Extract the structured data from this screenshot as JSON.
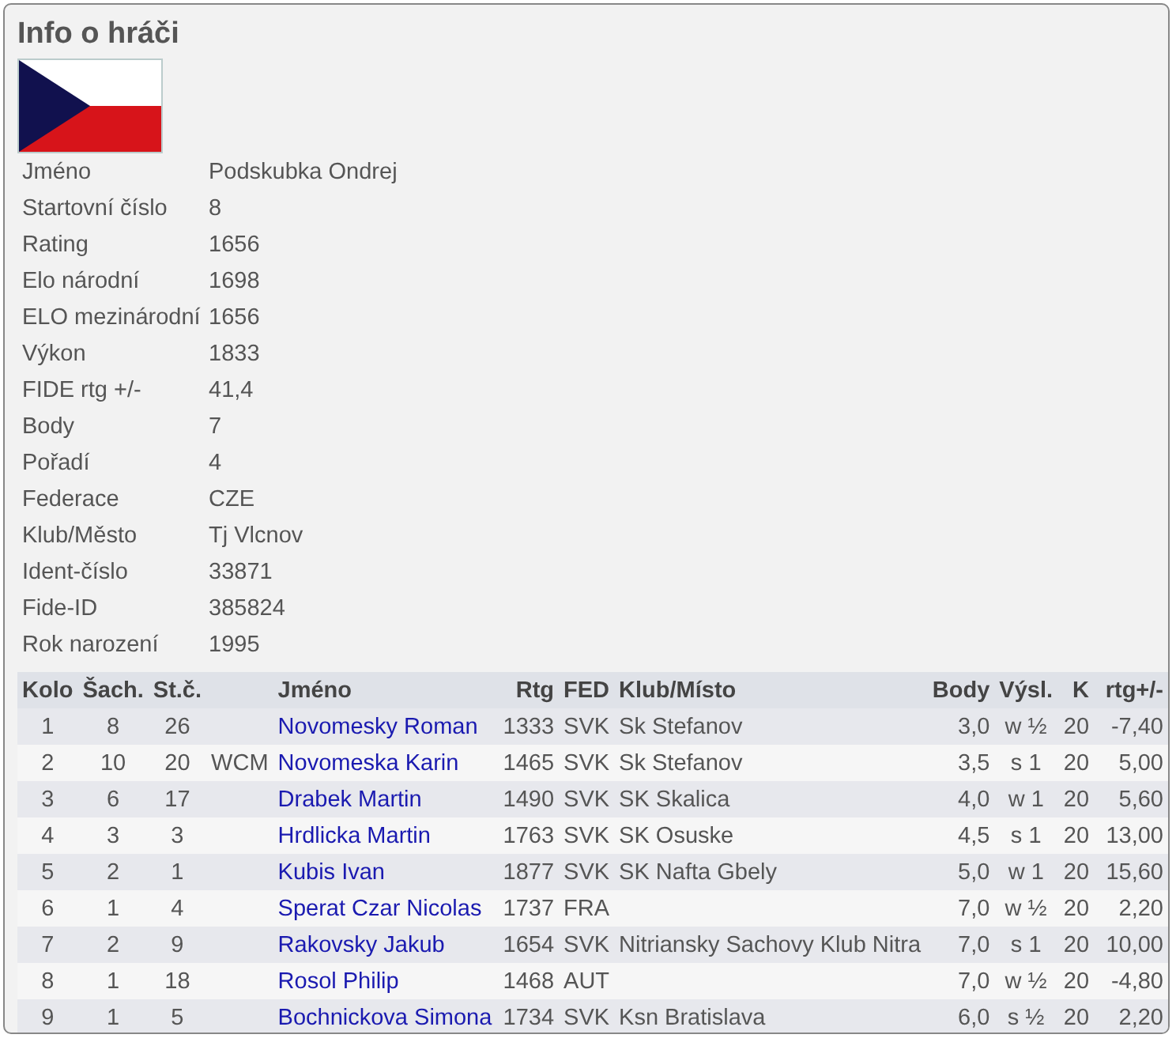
{
  "title": "Info o hráči",
  "flag": {
    "kind": "czech"
  },
  "info": [
    {
      "label": "Jméno",
      "value": "Podskubka Ondrej"
    },
    {
      "label": "Startovní číslo",
      "value": "8"
    },
    {
      "label": "Rating",
      "value": "1656"
    },
    {
      "label": "Elo národní",
      "value": "1698"
    },
    {
      "label": "ELO mezinárodní",
      "value": "1656"
    },
    {
      "label": "Výkon",
      "value": "1833"
    },
    {
      "label": "FIDE rtg +/-",
      "value": "41,4"
    },
    {
      "label": "Body",
      "value": "7"
    },
    {
      "label": "Pořadí",
      "value": "4"
    },
    {
      "label": "Federace",
      "value": "CZE"
    },
    {
      "label": "Klub/Město",
      "value": "Tj Vlcnov"
    },
    {
      "label": "Ident-číslo",
      "value": "33871"
    },
    {
      "label": "Fide-ID",
      "value": "385824"
    },
    {
      "label": "Rok narození",
      "value": "1995"
    }
  ],
  "table": {
    "columns": [
      "Kolo",
      "Šach.",
      "St.č.",
      "",
      "Jméno",
      "Rtg",
      "FED",
      "Klub/Místo",
      "Body",
      "Výsl.",
      "K",
      "rtg+/-"
    ],
    "rows": [
      [
        "1",
        "8",
        "26",
        "",
        "Novomesky Roman",
        "1333",
        "SVK",
        "Sk Stefanov",
        "3,0",
        "w ½",
        "20",
        "-7,40"
      ],
      [
        "2",
        "10",
        "20",
        "WCM",
        "Novomeska Karin",
        "1465",
        "SVK",
        "Sk Stefanov",
        "3,5",
        "s 1",
        "20",
        "5,00"
      ],
      [
        "3",
        "6",
        "17",
        "",
        "Drabek Martin",
        "1490",
        "SVK",
        "SK Skalica",
        "4,0",
        "w 1",
        "20",
        "5,60"
      ],
      [
        "4",
        "3",
        "3",
        "",
        "Hrdlicka Martin",
        "1763",
        "SVK",
        "SK Osuske",
        "4,5",
        "s 1",
        "20",
        "13,00"
      ],
      [
        "5",
        "2",
        "1",
        "",
        "Kubis Ivan",
        "1877",
        "SVK",
        "SK Nafta Gbely",
        "5,0",
        "w 1",
        "20",
        "15,60"
      ],
      [
        "6",
        "1",
        "4",
        "",
        "Sperat Czar Nicolas",
        "1737",
        "FRA",
        "",
        "7,0",
        "w ½",
        "20",
        "2,20"
      ],
      [
        "7",
        "2",
        "9",
        "",
        "Rakovsky Jakub",
        "1654",
        "SVK",
        "Nitriansky Sachovy Klub Nitra",
        "7,0",
        "s 1",
        "20",
        "10,00"
      ],
      [
        "8",
        "1",
        "18",
        "",
        "Rosol Philip",
        "1468",
        "AUT",
        "",
        "7,0",
        "w ½",
        "20",
        "-4,80"
      ],
      [
        "9",
        "1",
        "5",
        "",
        "Bochnickova Simona",
        "1734",
        "SVK",
        "Ksn Bratislava",
        "6,0",
        "s ½",
        "20",
        "2,20"
      ]
    ]
  }
}
